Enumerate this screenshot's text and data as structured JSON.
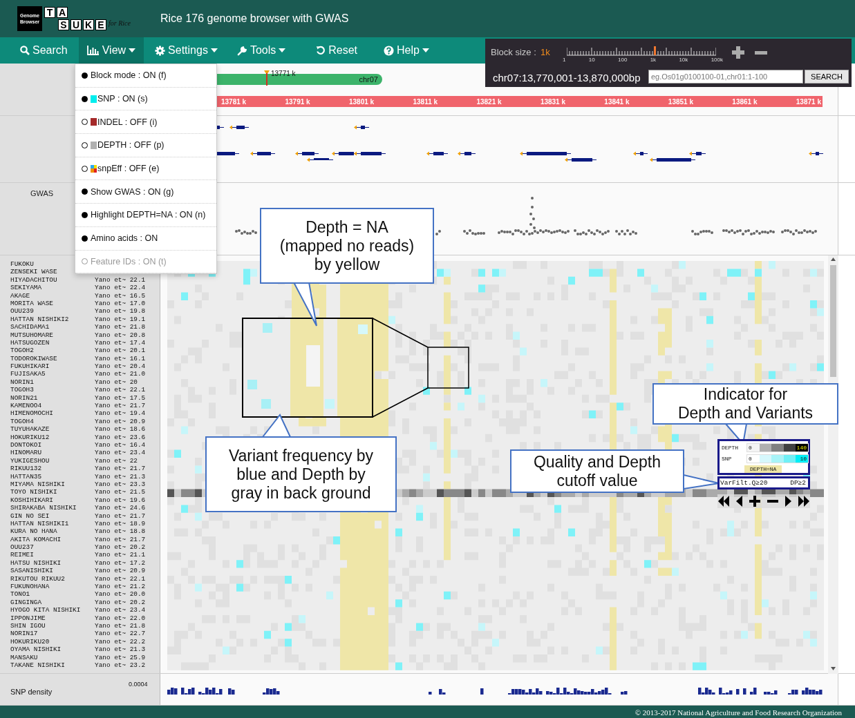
{
  "header": {
    "logo": {
      "badge": [
        "Genome",
        "Browser"
      ],
      "tiles_top": [
        "T",
        "A"
      ],
      "tiles_bottom": [
        "S",
        "U",
        "K",
        "E"
      ],
      "tagline": "for Rice"
    },
    "title": "Rice 176 genome browser with GWAS"
  },
  "nav": [
    {
      "label": "Search",
      "kind": "search",
      "selected": false,
      "dropdown": false
    },
    {
      "label": "View",
      "kind": "chart",
      "selected": true,
      "dropdown": true
    },
    {
      "label": "Settings",
      "kind": "gear",
      "selected": false,
      "dropdown": true
    },
    {
      "label": "Tools",
      "kind": "wrench",
      "selected": false,
      "dropdown": true
    },
    {
      "label": "Reset",
      "kind": "reset",
      "selected": false,
      "dropdown": false
    },
    {
      "label": "Help",
      "kind": "help",
      "selected": false,
      "dropdown": true
    }
  ],
  "view_menu": [
    {
      "label": "Block mode : ON (f)",
      "checked": true,
      "disabled": false
    },
    {
      "label": "SNP : ON (s)",
      "checked": true,
      "disabled": false,
      "kind": "solid",
      "color": "#00eeee"
    },
    {
      "label": "INDEL : OFF (i)",
      "checked": false,
      "disabled": false,
      "kind": "solid",
      "color": "#a52a2a"
    },
    {
      "label": "DEPTH : OFF (p)",
      "checked": false,
      "disabled": false,
      "kind": "solid",
      "color": "#b0b0b0"
    },
    {
      "label": "snpEff : OFF (e)",
      "checked": false,
      "disabled": false,
      "kind": "quad"
    },
    {
      "label": "Show GWAS : ON (g)",
      "checked": true,
      "disabled": false
    },
    {
      "label": "Highlight DEPTH=NA : ON (n)",
      "checked": true,
      "disabled": false
    },
    {
      "label": "Amino acids : ON",
      "checked": true,
      "disabled": false
    },
    {
      "label": "Feature IDs : ON (t)",
      "checked": false,
      "disabled": true
    }
  ],
  "block_size": {
    "label": "Block size :",
    "value": "1k",
    "scale": [
      "1",
      "10",
      "100",
      "1k",
      "10k",
      "100k"
    ],
    "level": 0.59
  },
  "location": {
    "region": "chr07:13,770,001-13,870,000bp",
    "placeholder": "eg.Os01g0100100-01,chr01:1-100",
    "button": "SEARCH"
  },
  "overview": {
    "position": "13771 k",
    "chromosome": "chr07"
  },
  "ruler": [
    "13781 k",
    "13791 k",
    "13801 k",
    "13811 k",
    "13821 k",
    "13831 k",
    "13841 k",
    "13851 k",
    "13861 k",
    "13871 k"
  ],
  "gwas": {
    "label": "GWAS"
  },
  "samples": [
    {
      "name": "FUKOKU"
    },
    {
      "name": "ZENSEKI WASE"
    },
    {
      "name": "HIYADACHITOU",
      "column_2": "Yano et~ 22.1"
    },
    {
      "name": "SEKIYAMA",
      "column_2": "Yano et~ 22.4"
    },
    {
      "name": "AKAGE",
      "column_2": "Yano et~ 16.5"
    },
    {
      "name": "MORITA WASE",
      "column_2": "Yano et~ 17.0"
    },
    {
      "name": "OUU239",
      "column_2": "Yano et~ 19.8"
    },
    {
      "name": "HATTAN NISHIKI2",
      "column_2": "Yano et~ 19.1"
    },
    {
      "name": "SACHIDAMA1",
      "column_2": "Yano et~ 21.8"
    },
    {
      "name": "MUTSUHOMARE",
      "column_2": "Yano et~ 20.8"
    },
    {
      "name": "HATSUGOZEN",
      "column_2": "Yano et~ 17.4"
    },
    {
      "name": "TOGOH2",
      "column_2": "Yano et~ 20.1"
    },
    {
      "name": "TODOROKIWASE",
      "column_2": "Yano et~ 16.1"
    },
    {
      "name": "FUKUHIKARI",
      "column_2": "Yano et~ 20.4"
    },
    {
      "name": "FUJISAKA5",
      "column_2": "Yano et~ 21.0"
    },
    {
      "name": "NORIN1",
      "column_2": "Yano et~ 20"
    },
    {
      "name": "TOGOH3",
      "column_2": "Yano et~ 22.1"
    },
    {
      "name": "NORIN21",
      "column_2": "Yano et~ 17.5"
    },
    {
      "name": "KAMENOO4",
      "column_2": "Yano et~ 21.7"
    },
    {
      "name": "HIMENOMOCHI",
      "column_2": "Yano et~ 19.4"
    },
    {
      "name": "TOGOH4",
      "column_2": "Yano et~ 20.9"
    },
    {
      "name": "TUYUHAKAZE",
      "column_2": "Yano et~ 18.6"
    },
    {
      "name": "HOKURIKU12",
      "column_2": "Yano et~ 23.6"
    },
    {
      "name": "DONTOKOI",
      "column_2": "Yano et~ 16.4"
    },
    {
      "name": "HINOMARU",
      "column_2": "Yano et~ 23.4"
    },
    {
      "name": "YUKIGESHOU",
      "column_2": "Yano et~ 22"
    },
    {
      "name": "RIKUU132",
      "column_2": "Yano et~ 21.7"
    },
    {
      "name": "HATTAN35",
      "column_2": "Yano et~ 21.3"
    },
    {
      "name": "MIYAMA NISHIKI",
      "column_2": "Yano et~ 23.3"
    },
    {
      "name": "TOYO NISHIKI",
      "column_2": "Yano et~ 21.5"
    },
    {
      "name": "KOSHIHIKARI",
      "column_2": "Yano et~ 19.6"
    },
    {
      "name": "SHIRAKABA NISHIKI",
      "column_2": "Yano et~ 24.6"
    },
    {
      "name": "GIN NO SEI",
      "column_2": "Yano et~ 21.7"
    },
    {
      "name": "HATTAN NISHIKI1",
      "column_2": "Yano et~ 18.9"
    },
    {
      "name": "KURA NO HANA",
      "column_2": "Yano et~ 18.8"
    },
    {
      "name": "AKITA KOMACHI",
      "column_2": "Yano et~ 21.7"
    },
    {
      "name": "OUU237",
      "column_2": "Yano et~ 20.2"
    },
    {
      "name": "REIMEI",
      "column_2": "Yano et~ 21.1"
    },
    {
      "name": "HATSU NISHIKI",
      "column_2": "Yano et~ 17.2"
    },
    {
      "name": "SASANISHIKI",
      "column_2": "Yano et~ 20.9"
    },
    {
      "name": "RIKUTOU RIKUU2",
      "column_2": "Yano et~ 22.1"
    },
    {
      "name": "FUKUNOHANA",
      "column_2": "Yano et~ 21.2"
    },
    {
      "name": "TONO1",
      "column_2": "Yano et~ 20.0"
    },
    {
      "name": "GINGINGA",
      "column_2": "Yano et~ 20.2"
    },
    {
      "name": "HYOGO KITA NISHIKI",
      "column_2": "Yano et~ 23.4"
    },
    {
      "name": "IPPONJIME",
      "column_2": "Yano et~ 22.0"
    },
    {
      "name": "SHIN IGOU",
      "column_2": "Yano et~ 21.8"
    },
    {
      "name": "NORIN17",
      "column_2": "Yano et~ 22.7"
    },
    {
      "name": "HOKURIKU20",
      "column_2": "Yano et~ 22.2"
    },
    {
      "name": "OYAMA NISHIKI",
      "column_2": "Yano et~ 21.3"
    },
    {
      "name": "MANSAKU",
      "column_2": "Yano et~ 25.9"
    },
    {
      "name": "TAKANE NISHIKI",
      "column_2": "Yano et~ 23.2"
    }
  ],
  "density": {
    "label": "SNP density",
    "max": "0.0004"
  },
  "legend": {
    "depth_label": "DEPTH",
    "depth_min": "0",
    "depth_max": "140",
    "snp_label": "SNP",
    "snp_min": "0",
    "snp_max": "10",
    "na_label": "DEPTH=NA",
    "filter_q": "VarFilt.Q≥20",
    "filter_dp": "DP≥2"
  },
  "callouts": [
    {
      "text": "Depth = NA\n(mapped no reads)\nby yellow"
    },
    {
      "text": "Variant frequency by\nblue and Depth by\ngray in back ground"
    },
    {
      "text": "Indicator for\nDepth and Variants"
    },
    {
      "text": "Quality and Depth\ncutoff value"
    }
  ],
  "footer": "© 2013-2017 National Agriculture and Food Research Organization"
}
